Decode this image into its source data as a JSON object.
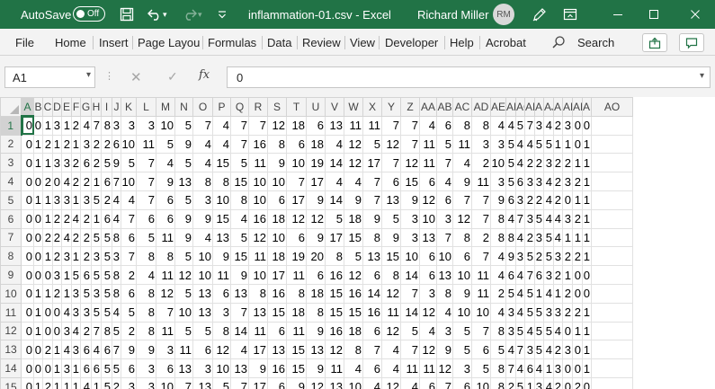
{
  "titlebar": {
    "autosave_label": "AutoSave",
    "autosave_state": "Off",
    "file_title": "inflammation-01.csv  -  Excel",
    "user_name": "Richard Miller",
    "user_initials": "RM",
    "accent_color": "#217346"
  },
  "ribbon": {
    "tabs": [
      "File",
      "Home",
      "Insert",
      "Page Layou",
      "Formulas",
      "Data",
      "Review",
      "View",
      "Developer",
      "Help",
      "Acrobat"
    ],
    "search_label": "Search"
  },
  "formula_bar": {
    "name_box": "A1",
    "fx_label": "fx",
    "value": "0"
  },
  "sheet": {
    "columns": [
      "A",
      "B",
      "C",
      "D",
      "E",
      "F",
      "G",
      "H",
      "I",
      "J",
      "K",
      "L",
      "M",
      "N",
      "O",
      "P",
      "Q",
      "R",
      "S",
      "T",
      "U",
      "V",
      "W",
      "X",
      "Y",
      "Z",
      "AA",
      "AB",
      "AC",
      "AD",
      "AE",
      "AF",
      "AG",
      "AH",
      "AI",
      "AJ",
      "AK",
      "AL",
      "AM",
      "AN",
      "AO"
    ],
    "row_numbers": [
      "1",
      "2",
      "3",
      "4",
      "5",
      "6",
      "7",
      "8",
      "9",
      "10",
      "11",
      "12",
      "13",
      "14",
      "15"
    ],
    "selected_cell": "A1",
    "rows": [
      [
        0,
        0,
        1,
        3,
        1,
        2,
        4,
        7,
        8,
        3,
        3,
        3,
        10,
        5,
        7,
        4,
        7,
        7,
        12,
        18,
        6,
        13,
        11,
        11,
        7,
        7,
        4,
        6,
        8,
        8,
        4,
        4,
        5,
        7,
        3,
        4,
        2,
        3,
        0,
        0
      ],
      [
        0,
        1,
        2,
        1,
        2,
        1,
        3,
        2,
        2,
        6,
        10,
        11,
        5,
        9,
        4,
        4,
        7,
        16,
        8,
        6,
        18,
        4,
        12,
        5,
        12,
        7,
        11,
        5,
        11,
        3,
        3,
        5,
        4,
        4,
        5,
        5,
        1,
        1,
        0,
        1
      ],
      [
        0,
        1,
        1,
        3,
        3,
        2,
        6,
        2,
        5,
        9,
        5,
        7,
        4,
        5,
        4,
        15,
        5,
        11,
        9,
        10,
        19,
        14,
        12,
        17,
        7,
        12,
        11,
        7,
        4,
        2,
        10,
        5,
        4,
        2,
        2,
        3,
        2,
        2,
        1,
        1
      ],
      [
        0,
        0,
        2,
        0,
        4,
        2,
        2,
        1,
        6,
        7,
        10,
        7,
        9,
        13,
        8,
        8,
        15,
        10,
        10,
        7,
        17,
        4,
        4,
        7,
        6,
        15,
        6,
        4,
        9,
        11,
        3,
        5,
        6,
        3,
        3,
        4,
        2,
        3,
        2,
        1
      ],
      [
        0,
        1,
        1,
        3,
        3,
        1,
        3,
        5,
        2,
        4,
        4,
        7,
        6,
        5,
        3,
        10,
        8,
        10,
        6,
        17,
        9,
        14,
        9,
        7,
        13,
        9,
        12,
        6,
        7,
        7,
        9,
        6,
        3,
        2,
        2,
        4,
        2,
        0,
        1,
        1
      ],
      [
        0,
        0,
        1,
        2,
        2,
        4,
        2,
        1,
        6,
        4,
        7,
        6,
        6,
        9,
        9,
        15,
        4,
        16,
        18,
        12,
        12,
        5,
        18,
        9,
        5,
        3,
        10,
        3,
        12,
        7,
        8,
        4,
        7,
        3,
        5,
        4,
        4,
        3,
        2,
        1
      ],
      [
        0,
        0,
        2,
        2,
        4,
        2,
        2,
        5,
        5,
        8,
        6,
        5,
        11,
        9,
        4,
        13,
        5,
        12,
        10,
        6,
        9,
        17,
        15,
        8,
        9,
        3,
        13,
        7,
        8,
        2,
        8,
        8,
        4,
        2,
        3,
        5,
        4,
        1,
        1,
        1
      ],
      [
        0,
        0,
        1,
        2,
        3,
        1,
        2,
        3,
        5,
        3,
        7,
        8,
        8,
        5,
        10,
        9,
        15,
        11,
        18,
        19,
        20,
        8,
        5,
        13,
        15,
        10,
        6,
        10,
        6,
        7,
        4,
        9,
        3,
        5,
        2,
        5,
        3,
        2,
        2,
        1
      ],
      [
        0,
        0,
        0,
        3,
        1,
        5,
        6,
        5,
        5,
        8,
        2,
        4,
        11,
        12,
        10,
        11,
        9,
        10,
        17,
        11,
        6,
        16,
        12,
        6,
        8,
        14,
        6,
        13,
        10,
        11,
        4,
        6,
        4,
        7,
        6,
        3,
        2,
        1,
        0,
        0
      ],
      [
        0,
        1,
        1,
        2,
        1,
        3,
        5,
        3,
        5,
        8,
        6,
        8,
        12,
        5,
        13,
        6,
        13,
        8,
        16,
        8,
        18,
        15,
        16,
        14,
        12,
        7,
        3,
        8,
        9,
        11,
        2,
        5,
        4,
        5,
        1,
        4,
        1,
        2,
        0,
        0
      ],
      [
        0,
        1,
        0,
        0,
        4,
        3,
        3,
        5,
        5,
        4,
        5,
        8,
        7,
        10,
        13,
        3,
        7,
        13,
        15,
        18,
        8,
        15,
        15,
        16,
        11,
        14,
        12,
        4,
        10,
        10,
        4,
        3,
        4,
        5,
        5,
        3,
        3,
        2,
        2,
        1
      ],
      [
        0,
        1,
        0,
        0,
        3,
        4,
        2,
        7,
        8,
        5,
        2,
        8,
        11,
        5,
        5,
        8,
        14,
        11,
        6,
        11,
        9,
        16,
        18,
        6,
        12,
        5,
        4,
        3,
        5,
        7,
        8,
        3,
        5,
        4,
        5,
        5,
        4,
        0,
        1,
        1
      ],
      [
        0,
        0,
        2,
        1,
        4,
        3,
        6,
        4,
        6,
        7,
        9,
        9,
        3,
        11,
        6,
        12,
        4,
        17,
        13,
        15,
        13,
        12,
        8,
        7,
        4,
        7,
        12,
        9,
        5,
        6,
        5,
        4,
        7,
        3,
        5,
        4,
        2,
        3,
        0,
        1
      ],
      [
        0,
        0,
        0,
        1,
        3,
        1,
        6,
        6,
        5,
        5,
        6,
        3,
        6,
        13,
        3,
        10,
        13,
        9,
        16,
        15,
        9,
        11,
        4,
        6,
        4,
        11,
        11,
        12,
        3,
        5,
        8,
        7,
        4,
        6,
        4,
        1,
        3,
        0,
        0,
        1
      ],
      [
        0,
        1,
        2,
        1,
        1,
        1,
        4,
        1,
        5,
        2,
        3,
        3,
        10,
        7,
        13,
        5,
        7,
        17,
        6,
        9,
        12,
        13,
        10,
        4,
        12,
        4,
        6,
        7,
        6,
        10,
        8,
        2,
        5,
        1,
        3,
        4,
        2,
        0,
        2,
        0
      ]
    ]
  }
}
